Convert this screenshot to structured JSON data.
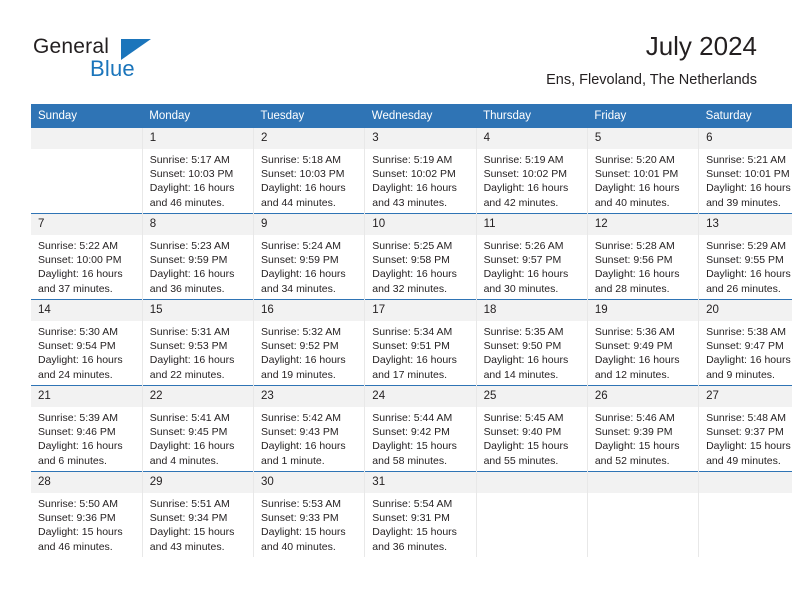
{
  "logo": {
    "word_top": "General",
    "word_bottom": "Blue",
    "accent_color": "#1b75bb"
  },
  "header": {
    "title": "July 2024",
    "subtitle": "Ens, Flevoland, The Netherlands",
    "header_bg_color": "#2f74b5",
    "daynum_bg_color": "#f2f2f2"
  },
  "weekdays": [
    "Sunday",
    "Monday",
    "Tuesday",
    "Wednesday",
    "Thursday",
    "Friday",
    "Saturday"
  ],
  "weeks": [
    [
      {
        "day": "",
        "empty": true
      },
      {
        "day": "1",
        "sunrise": "Sunrise: 5:17 AM",
        "sunset": "Sunset: 10:03 PM",
        "daylight1": "Daylight: 16 hours",
        "daylight2": "and 46 minutes."
      },
      {
        "day": "2",
        "sunrise": "Sunrise: 5:18 AM",
        "sunset": "Sunset: 10:03 PM",
        "daylight1": "Daylight: 16 hours",
        "daylight2": "and 44 minutes."
      },
      {
        "day": "3",
        "sunrise": "Sunrise: 5:19 AM",
        "sunset": "Sunset: 10:02 PM",
        "daylight1": "Daylight: 16 hours",
        "daylight2": "and 43 minutes."
      },
      {
        "day": "4",
        "sunrise": "Sunrise: 5:19 AM",
        "sunset": "Sunset: 10:02 PM",
        "daylight1": "Daylight: 16 hours",
        "daylight2": "and 42 minutes."
      },
      {
        "day": "5",
        "sunrise": "Sunrise: 5:20 AM",
        "sunset": "Sunset: 10:01 PM",
        "daylight1": "Daylight: 16 hours",
        "daylight2": "and 40 minutes."
      },
      {
        "day": "6",
        "sunrise": "Sunrise: 5:21 AM",
        "sunset": "Sunset: 10:01 PM",
        "daylight1": "Daylight: 16 hours",
        "daylight2": "and 39 minutes."
      }
    ],
    [
      {
        "day": "7",
        "sunrise": "Sunrise: 5:22 AM",
        "sunset": "Sunset: 10:00 PM",
        "daylight1": "Daylight: 16 hours",
        "daylight2": "and 37 minutes."
      },
      {
        "day": "8",
        "sunrise": "Sunrise: 5:23 AM",
        "sunset": "Sunset: 9:59 PM",
        "daylight1": "Daylight: 16 hours",
        "daylight2": "and 36 minutes."
      },
      {
        "day": "9",
        "sunrise": "Sunrise: 5:24 AM",
        "sunset": "Sunset: 9:59 PM",
        "daylight1": "Daylight: 16 hours",
        "daylight2": "and 34 minutes."
      },
      {
        "day": "10",
        "sunrise": "Sunrise: 5:25 AM",
        "sunset": "Sunset: 9:58 PM",
        "daylight1": "Daylight: 16 hours",
        "daylight2": "and 32 minutes."
      },
      {
        "day": "11",
        "sunrise": "Sunrise: 5:26 AM",
        "sunset": "Sunset: 9:57 PM",
        "daylight1": "Daylight: 16 hours",
        "daylight2": "and 30 minutes."
      },
      {
        "day": "12",
        "sunrise": "Sunrise: 5:28 AM",
        "sunset": "Sunset: 9:56 PM",
        "daylight1": "Daylight: 16 hours",
        "daylight2": "and 28 minutes."
      },
      {
        "day": "13",
        "sunrise": "Sunrise: 5:29 AM",
        "sunset": "Sunset: 9:55 PM",
        "daylight1": "Daylight: 16 hours",
        "daylight2": "and 26 minutes."
      }
    ],
    [
      {
        "day": "14",
        "sunrise": "Sunrise: 5:30 AM",
        "sunset": "Sunset: 9:54 PM",
        "daylight1": "Daylight: 16 hours",
        "daylight2": "and 24 minutes."
      },
      {
        "day": "15",
        "sunrise": "Sunrise: 5:31 AM",
        "sunset": "Sunset: 9:53 PM",
        "daylight1": "Daylight: 16 hours",
        "daylight2": "and 22 minutes."
      },
      {
        "day": "16",
        "sunrise": "Sunrise: 5:32 AM",
        "sunset": "Sunset: 9:52 PM",
        "daylight1": "Daylight: 16 hours",
        "daylight2": "and 19 minutes."
      },
      {
        "day": "17",
        "sunrise": "Sunrise: 5:34 AM",
        "sunset": "Sunset: 9:51 PM",
        "daylight1": "Daylight: 16 hours",
        "daylight2": "and 17 minutes."
      },
      {
        "day": "18",
        "sunrise": "Sunrise: 5:35 AM",
        "sunset": "Sunset: 9:50 PM",
        "daylight1": "Daylight: 16 hours",
        "daylight2": "and 14 minutes."
      },
      {
        "day": "19",
        "sunrise": "Sunrise: 5:36 AM",
        "sunset": "Sunset: 9:49 PM",
        "daylight1": "Daylight: 16 hours",
        "daylight2": "and 12 minutes."
      },
      {
        "day": "20",
        "sunrise": "Sunrise: 5:38 AM",
        "sunset": "Sunset: 9:47 PM",
        "daylight1": "Daylight: 16 hours",
        "daylight2": "and 9 minutes."
      }
    ],
    [
      {
        "day": "21",
        "sunrise": "Sunrise: 5:39 AM",
        "sunset": "Sunset: 9:46 PM",
        "daylight1": "Daylight: 16 hours",
        "daylight2": "and 6 minutes."
      },
      {
        "day": "22",
        "sunrise": "Sunrise: 5:41 AM",
        "sunset": "Sunset: 9:45 PM",
        "daylight1": "Daylight: 16 hours",
        "daylight2": "and 4 minutes."
      },
      {
        "day": "23",
        "sunrise": "Sunrise: 5:42 AM",
        "sunset": "Sunset: 9:43 PM",
        "daylight1": "Daylight: 16 hours",
        "daylight2": "and 1 minute."
      },
      {
        "day": "24",
        "sunrise": "Sunrise: 5:44 AM",
        "sunset": "Sunset: 9:42 PM",
        "daylight1": "Daylight: 15 hours",
        "daylight2": "and 58 minutes."
      },
      {
        "day": "25",
        "sunrise": "Sunrise: 5:45 AM",
        "sunset": "Sunset: 9:40 PM",
        "daylight1": "Daylight: 15 hours",
        "daylight2": "and 55 minutes."
      },
      {
        "day": "26",
        "sunrise": "Sunrise: 5:46 AM",
        "sunset": "Sunset: 9:39 PM",
        "daylight1": "Daylight: 15 hours",
        "daylight2": "and 52 minutes."
      },
      {
        "day": "27",
        "sunrise": "Sunrise: 5:48 AM",
        "sunset": "Sunset: 9:37 PM",
        "daylight1": "Daylight: 15 hours",
        "daylight2": "and 49 minutes."
      }
    ],
    [
      {
        "day": "28",
        "sunrise": "Sunrise: 5:50 AM",
        "sunset": "Sunset: 9:36 PM",
        "daylight1": "Daylight: 15 hours",
        "daylight2": "and 46 minutes."
      },
      {
        "day": "29",
        "sunrise": "Sunrise: 5:51 AM",
        "sunset": "Sunset: 9:34 PM",
        "daylight1": "Daylight: 15 hours",
        "daylight2": "and 43 minutes."
      },
      {
        "day": "30",
        "sunrise": "Sunrise: 5:53 AM",
        "sunset": "Sunset: 9:33 PM",
        "daylight1": "Daylight: 15 hours",
        "daylight2": "and 40 minutes."
      },
      {
        "day": "31",
        "sunrise": "Sunrise: 5:54 AM",
        "sunset": "Sunset: 9:31 PM",
        "daylight1": "Daylight: 15 hours",
        "daylight2": "and 36 minutes."
      },
      {
        "day": "",
        "empty": true
      },
      {
        "day": "",
        "empty": true
      },
      {
        "day": "",
        "empty": true
      }
    ]
  ]
}
